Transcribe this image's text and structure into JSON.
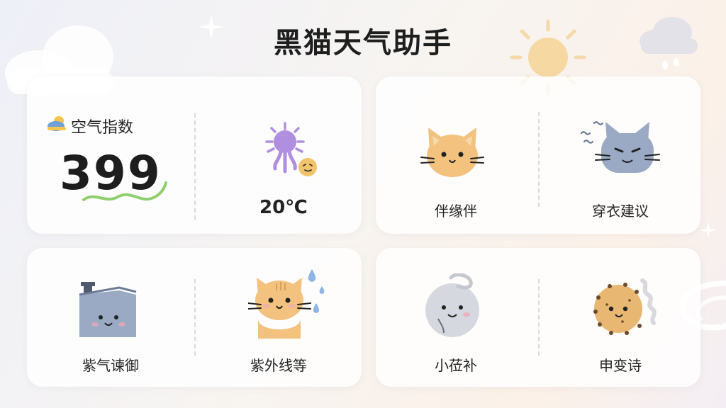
{
  "app": {
    "title": "黑猫天气助手"
  },
  "air_quality": {
    "title": "空气指数",
    "value": "399",
    "temperature": "20℃"
  },
  "cards": {
    "top_right": {
      "left_label": "伴缘伴",
      "right_label": "穿衣建议"
    },
    "bottom_left": {
      "left_label": "紫气谏御",
      "right_label": "紫外线等"
    },
    "bottom_right": {
      "left_label": "小莅补",
      "right_label": "申变诗"
    }
  },
  "icons": {
    "title_icon": "cloud-sun-icon",
    "sun": "sun-icon",
    "cat_happy": "cat-face-icon",
    "cat_grumpy": "grumpy-cat-icon",
    "house": "house-icon",
    "cat_rain": "cat-raindrops-icon",
    "moon": "moon-face-icon",
    "dust": "dust-ball-icon"
  },
  "colors": {
    "accent_green": "#8fcf6e",
    "purple": "#b08ee0",
    "cat_orange": "#f2c27e",
    "cat_blue": "#9aaac4"
  }
}
